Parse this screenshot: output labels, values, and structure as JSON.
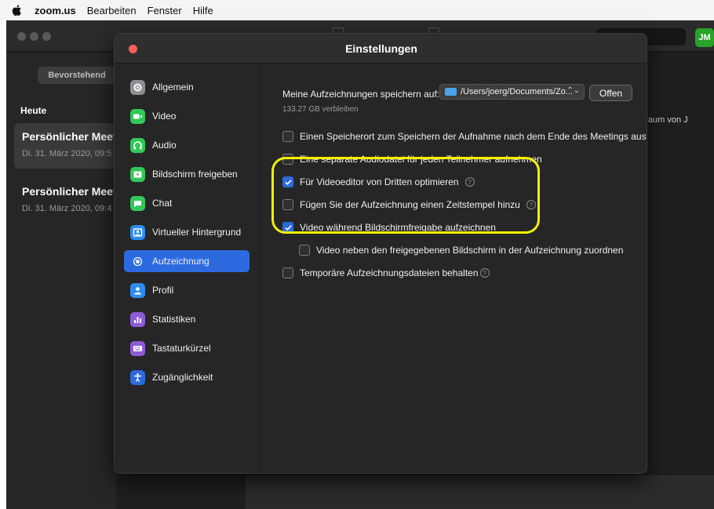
{
  "menubar": {
    "app": "zoom.us",
    "items": [
      "Bearbeiten",
      "Fenster",
      "Hilfe"
    ]
  },
  "main": {
    "avatar": "JM",
    "tab_upcoming": "Bevorstehend",
    "today": "Heute",
    "meetings": [
      {
        "title": "Persönlicher Meet",
        "date": "Di. 31. März 2020, 09:5"
      },
      {
        "title": "Persönlicher Meet",
        "date": "Di. 31. März 2020, 09:4"
      }
    ],
    "bg_text": "ngraum von J"
  },
  "dialog": {
    "title": "Einstellungen",
    "sidebar": [
      {
        "label": "Allgemein",
        "icon": "gear-icon",
        "color": "#8e8e93"
      },
      {
        "label": "Video",
        "icon": "video-camera-icon",
        "color": "#34c759"
      },
      {
        "label": "Audio",
        "icon": "headphones-icon",
        "color": "#34c759"
      },
      {
        "label": "Bildschirm freigeben",
        "icon": "share-screen-icon",
        "color": "#34c759"
      },
      {
        "label": "Chat",
        "icon": "chat-bubble-icon",
        "color": "#34c759"
      },
      {
        "label": "Virtueller Hintergrund",
        "icon": "portrait-icon",
        "color": "#2d8cf0"
      },
      {
        "label": "Aufzeichnung",
        "icon": "record-icon",
        "color": "#2d6adf"
      },
      {
        "label": "Profil",
        "icon": "person-icon",
        "color": "#2d8cf0"
      },
      {
        "label": "Statistiken",
        "icon": "bar-chart-icon",
        "color": "#8e5bd9"
      },
      {
        "label": "Tastaturkürzel",
        "icon": "keyboard-icon",
        "color": "#8e5bd9"
      },
      {
        "label": "Zugänglichkeit",
        "icon": "accessibility-icon",
        "color": "#2d6adf"
      }
    ],
    "active_index": 6,
    "recording": {
      "save_label": "Meine Aufzeichnungen speichern auf:",
      "path": "/Users/joerg/Documents/Zo...",
      "open_button": "Offen",
      "remaining": "133.27 GB verbleiben",
      "options": [
        {
          "label": "Einen Speicherort zum Speichern der Aufnahme nach dem Ende des Meetings ausw...",
          "checked": false,
          "help": false
        },
        {
          "label": "Eine separate Audiodatei für jeden Teilnehmer aufnehmen",
          "checked": false,
          "help": false
        },
        {
          "label": "Für Videoeditor von Dritten optimieren",
          "checked": true,
          "help": true
        },
        {
          "label": "Fügen Sie der Aufzeichnung einen Zeitstempel hinzu",
          "checked": false,
          "help": true
        },
        {
          "label": "Video während Bildschirmfreigabe aufzeichnen",
          "checked": true,
          "help": false
        },
        {
          "label": "Video neben den freigegebenen Bildschirm in der Aufzeichnung zuordnen",
          "checked": false,
          "help": false
        },
        {
          "label": "Temporäre Aufzeichnungsdateien behalten",
          "checked": false,
          "help": true
        }
      ]
    },
    "highlight_color": "#f2f200"
  }
}
